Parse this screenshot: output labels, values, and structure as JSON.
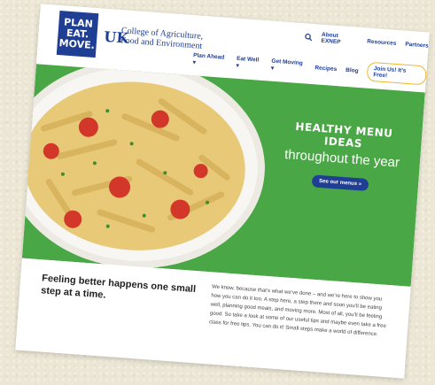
{
  "logo": {
    "line1": "PLAN",
    "line2": "EAT.",
    "line3": "MOVE."
  },
  "college": {
    "line1": "College of Agriculture,",
    "line2": "Food and Environment"
  },
  "util_nav": {
    "search_icon": "search-icon",
    "about": "About EXNEP",
    "resources": "Resources",
    "partners": "Partners"
  },
  "main_nav": {
    "items": [
      "Plan Ahead ▾",
      "Eat Well ▾",
      "Get Moving ▾",
      "Recipes",
      "Blog"
    ],
    "join": "Join Us! It’s Free!"
  },
  "hero": {
    "title_line1": "HEALTHY MENU",
    "title_line2": "IDEAS",
    "subtitle": "throughout the year",
    "button": "See our menus »"
  },
  "intro": {
    "tagline": "Feeling better happens one small step at a time.",
    "body": "We know, because that’s what we’ve done – and we’re here to show you how you can do it too. A step here, a step there and soon you’ll be eating well, planning good meals, and moving more. Most of all, you’ll be feeling good. So take a look at some of our useful tips and maybe even take a free class for free tips. You can do it! Small steps make a world of difference."
  },
  "colors": {
    "brand_blue": "#1f3f94",
    "hero_green": "#4aa746",
    "join_border": "#f0b72a"
  }
}
